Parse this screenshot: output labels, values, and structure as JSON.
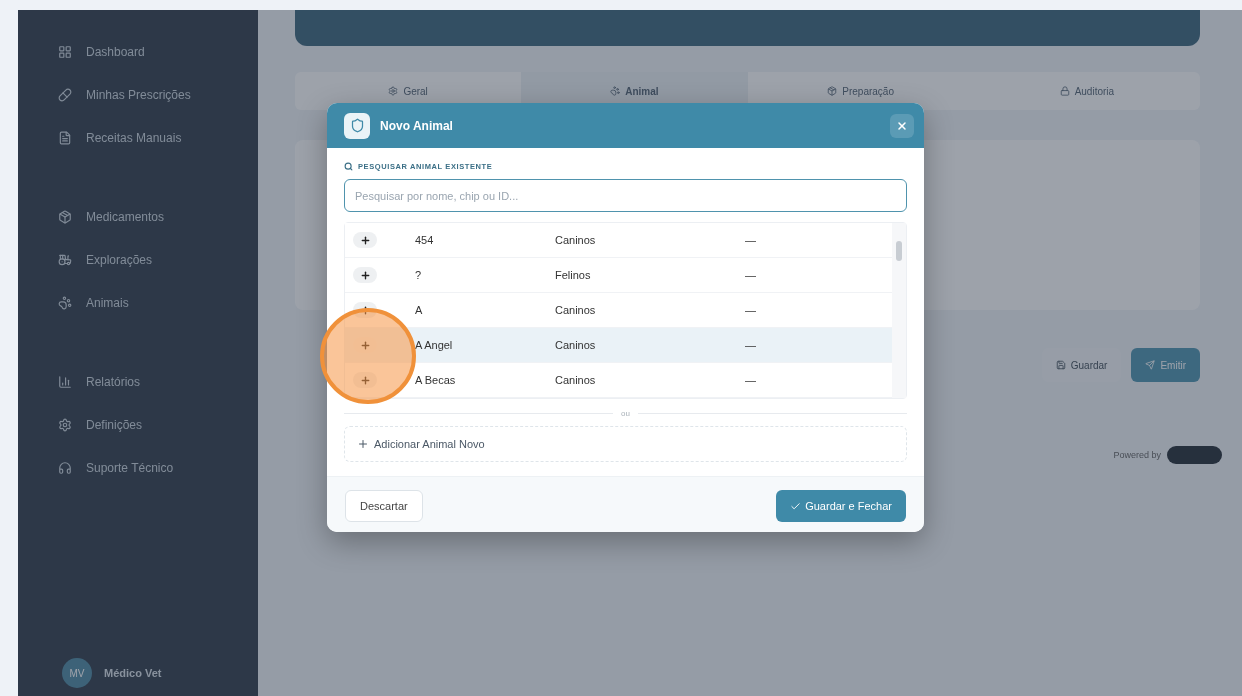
{
  "sidebar": {
    "items": [
      {
        "label": "Dashboard",
        "selected": false
      },
      {
        "label": "Minhas Prescrições",
        "selected": false
      },
      {
        "label": "Receitas Manuais",
        "selected": false
      },
      {
        "label": "Medicamentos",
        "selected": false
      },
      {
        "label": "Explorações",
        "selected": false
      },
      {
        "label": "Animais",
        "selected": false
      },
      {
        "label": "Relatórios",
        "selected": false
      },
      {
        "label": "Definições",
        "selected": false
      },
      {
        "label": "Suporte Técnico",
        "selected": false
      }
    ],
    "user": {
      "initials": "MV",
      "name": "Médico Vet"
    }
  },
  "tabs": [
    {
      "label": "Geral",
      "selected": false
    },
    {
      "label": "Animal",
      "selected": true
    },
    {
      "label": "Preparação",
      "selected": false
    },
    {
      "label": "Auditoria",
      "selected": false
    }
  ],
  "actions": [
    "Guardar",
    "Emitir"
  ],
  "powered_by": "Powered by",
  "modal": {
    "title": "Novo Animal",
    "search_label": "PESQUISAR ANIMAL EXISTENTE",
    "search": {
      "placeholder": "Pesquisar por nome, chip ou ID..."
    },
    "rows": [
      {
        "name": "454",
        "species": "Caninos",
        "column_3": "—",
        "selected": false
      },
      {
        "name": "?",
        "species": "Felinos",
        "column_3": "—",
        "selected": false
      },
      {
        "name": "A",
        "species": "Caninos",
        "column_3": "—",
        "selected": false
      },
      {
        "name": "A Angel",
        "species": "Caninos",
        "column_3": "—",
        "selected": true
      },
      {
        "name": "A Becas",
        "species": "Caninos",
        "column_3": "—",
        "selected": false
      }
    ],
    "divider": "ou",
    "add_button": "Adicionar Animal Novo",
    "discard_button": "Descartar",
    "save_button": "Guardar e Fechar"
  }
}
